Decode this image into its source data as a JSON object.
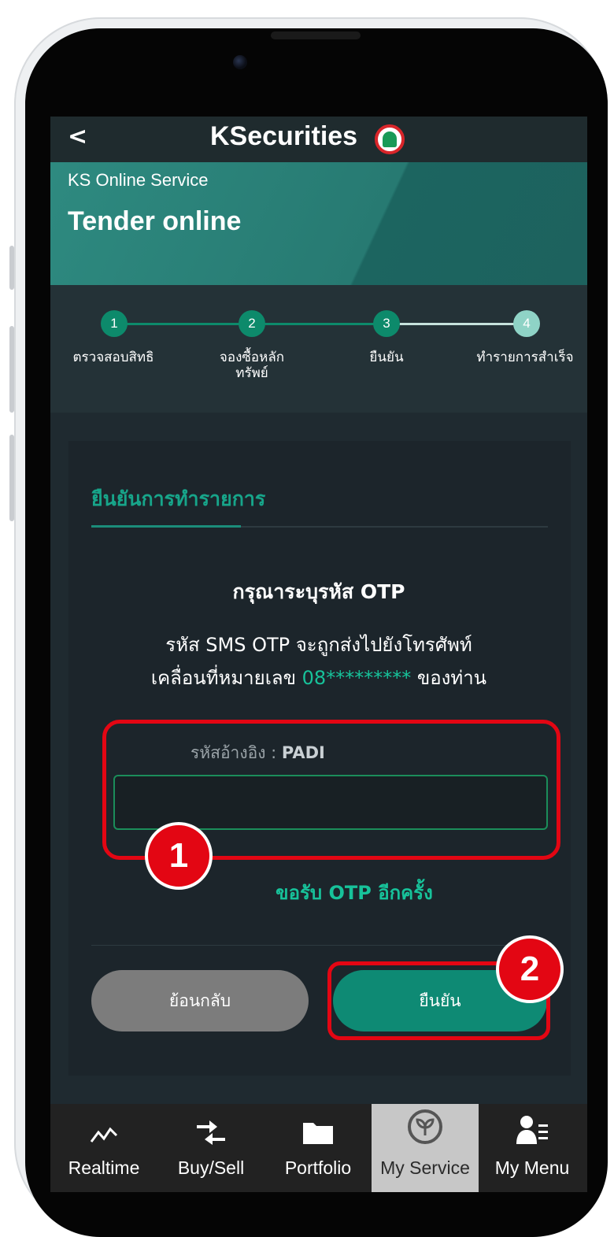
{
  "header": {
    "back_glyph": "<",
    "brand": "KSecurities"
  },
  "banner": {
    "subtitle": "KS Online Service",
    "title": "Tender online"
  },
  "steps": [
    {
      "number": "1",
      "label": "ตรวจสอบสิทธิ"
    },
    {
      "number": "2",
      "label": "จองซื้อหลัก ทรัพย์"
    },
    {
      "number": "3",
      "label": "ยืนยัน"
    },
    {
      "number": "4",
      "label": "ทำรายการสำเร็จ"
    }
  ],
  "card": {
    "title": "ยืนยันการทำรายการ",
    "otp_title": "กรุณาระบุรหัส OTP",
    "desc_line1": "รหัส SMS OTP จะถูกส่งไปยังโทรศัพท์",
    "desc_line2_prefix": "เคลื่อนที่หมายเลข",
    "phone_masked": "08*********",
    "desc_line2_suffix": "ของท่าน",
    "ref_label": "รหัสอ้างอิง :",
    "ref_code": "PADI",
    "otp_value": "",
    "resend": "ขอรับ OTP อีกครั้ง",
    "back_button": "ย้อนกลับ",
    "confirm_button": "ยืนยัน"
  },
  "tabbar": [
    {
      "label": "Realtime",
      "icon": "realtime-icon"
    },
    {
      "label": "Buy/Sell",
      "icon": "buy-sell-icon"
    },
    {
      "label": "Portfolio",
      "icon": "folder-icon"
    },
    {
      "label": "My Service",
      "icon": "my-service-icon",
      "active": true
    },
    {
      "label": "My Menu",
      "icon": "my-menu-icon"
    }
  ],
  "annotations": {
    "badge1": "1",
    "badge2": "2"
  },
  "colors": {
    "accent": "#17a58a",
    "highlight": "#e30613",
    "confirm": "#0e8a74"
  }
}
